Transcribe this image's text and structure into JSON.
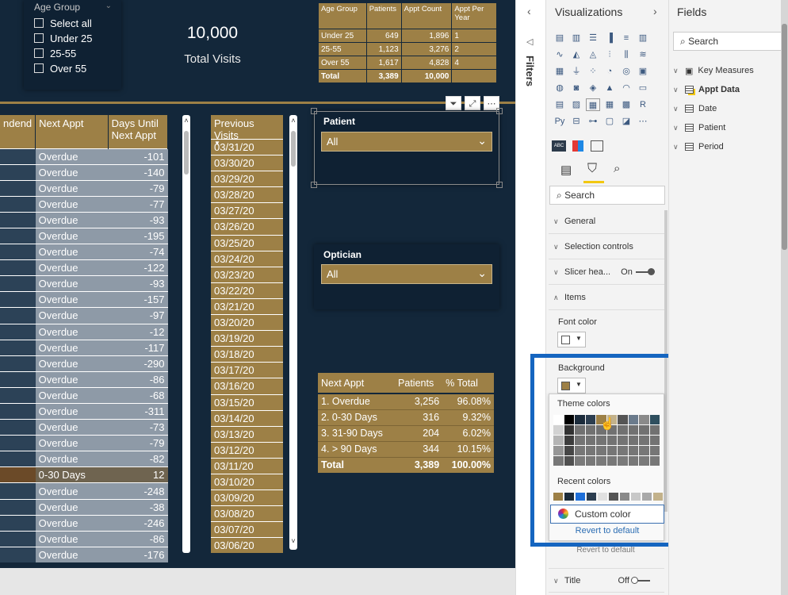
{
  "age_slicer": {
    "title": "Age Group",
    "items": [
      "Select all",
      "Under 25",
      "25-55",
      "Over 55"
    ]
  },
  "kpi": {
    "value": "10,000",
    "label": "Total Visits"
  },
  "age_table": {
    "headers": [
      "Age Group",
      "Patients",
      "Appt Count",
      "Appt Per Year"
    ],
    "rows": [
      [
        "Under 25",
        "649",
        "1,896",
        "1"
      ],
      [
        "25-55",
        "1,123",
        "3,276",
        "2"
      ],
      [
        "Over 55",
        "1,617",
        "4,828",
        "4"
      ]
    ],
    "total": [
      "Total",
      "3,389",
      "10,000",
      ""
    ]
  },
  "main_table": {
    "headers": [
      "ndend",
      "Next Appt",
      "Days Until Next Appt"
    ],
    "rows": [
      [
        "Overdue",
        "-101"
      ],
      [
        "Overdue",
        "-140"
      ],
      [
        "Overdue",
        "-79"
      ],
      [
        "Overdue",
        "-77"
      ],
      [
        "Overdue",
        "-93"
      ],
      [
        "Overdue",
        "-195"
      ],
      [
        "Overdue",
        "-74"
      ],
      [
        "Overdue",
        "-122"
      ],
      [
        "Overdue",
        "-93"
      ],
      [
        "Overdue",
        "-157"
      ],
      [
        "Overdue",
        "-97"
      ],
      [
        "Overdue",
        "-12"
      ],
      [
        "Overdue",
        "-117"
      ],
      [
        "Overdue",
        "-290"
      ],
      [
        "Overdue",
        "-86"
      ],
      [
        "Overdue",
        "-68"
      ],
      [
        "Overdue",
        "-311"
      ],
      [
        "Overdue",
        "-73"
      ],
      [
        "Overdue",
        "-79"
      ],
      [
        "Overdue",
        "-82"
      ],
      [
        "0-30 Days",
        "12"
      ],
      [
        "Overdue",
        "-248"
      ],
      [
        "Overdue",
        "-38"
      ],
      [
        "Overdue",
        "-246"
      ],
      [
        "Overdue",
        "-86"
      ],
      [
        "Overdue",
        "-176"
      ]
    ]
  },
  "prev_visits": {
    "header": "Previous Visits",
    "items": [
      "03/31/20",
      "03/30/20",
      "03/29/20",
      "03/28/20",
      "03/27/20",
      "03/26/20",
      "03/25/20",
      "03/24/20",
      "03/23/20",
      "03/22/20",
      "03/21/20",
      "03/20/20",
      "03/19/20",
      "03/18/20",
      "03/17/20",
      "03/16/20",
      "03/15/20",
      "03/14/20",
      "03/13/20",
      "03/12/20",
      "03/11/20",
      "03/10/20",
      "03/09/20",
      "03/08/20",
      "03/07/20",
      "03/06/20"
    ]
  },
  "patient_slicer": {
    "title": "Patient",
    "value": "All"
  },
  "optician_slicer": {
    "title": "Optician",
    "value": "All"
  },
  "next_table": {
    "headers": [
      "Next Appt",
      "Patients",
      "% Total"
    ],
    "rows": [
      [
        "1. Overdue",
        "3,256",
        "96.08%"
      ],
      [
        "2. 0-30 Days",
        "316",
        "9.32%"
      ],
      [
        "3. 31-90 Days",
        "204",
        "6.02%"
      ],
      [
        "4. > 90 Days",
        "344",
        "10.15%"
      ]
    ],
    "total": [
      "Total",
      "3,389",
      "100.00%"
    ]
  },
  "filters_pane": {
    "label": "Filters"
  },
  "vis_pane": {
    "title": "Visualizations",
    "search_placeholder": "Search",
    "sections": {
      "general": "General",
      "selection": "Selection controls",
      "slicer_header": "Slicer hea...",
      "slicer_header_state": "On",
      "items": "Items",
      "font_color": "Font color",
      "background": "Background",
      "title": "Title",
      "title_state": "Off"
    },
    "picker": {
      "theme_label": "Theme colors",
      "recent_label": "Recent colors",
      "custom_label": "Custom color",
      "revert_label": "Revert to default"
    },
    "revert_below": "Revert to default"
  },
  "fields_pane": {
    "title": "Fields",
    "search_placeholder": "Search",
    "items": [
      "Key Measures",
      "Appt Data",
      "Date",
      "Patient",
      "Period"
    ]
  },
  "colors": {
    "canvas": "#13273a",
    "gold": "#9d8046",
    "highlight": "#1565c0"
  }
}
